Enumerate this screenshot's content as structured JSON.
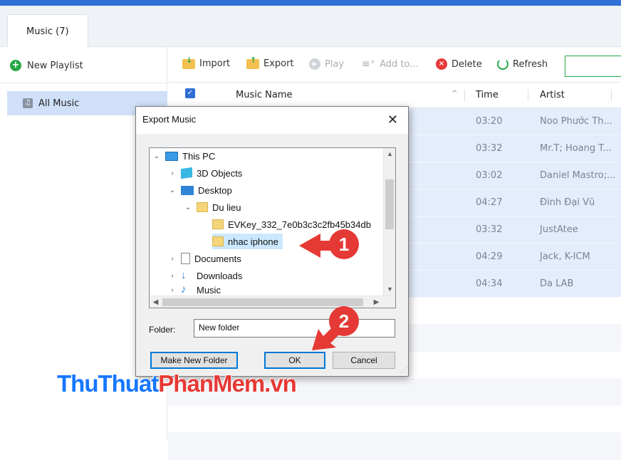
{
  "tab": {
    "label": "Music (7)"
  },
  "sidebar": {
    "new_playlist": "New Playlist",
    "all_music": "All Music"
  },
  "toolbar": {
    "import": "Import",
    "export": "Export",
    "play": "Play",
    "add_to": "Add to...",
    "delete": "Delete",
    "refresh": "Refresh"
  },
  "table": {
    "headers": {
      "name": "Music Name",
      "time": "Time",
      "artist": "Artist"
    },
    "rows": [
      {
        "time": "03:20",
        "artist": "Noo Phước Th..."
      },
      {
        "time": "03:32",
        "artist": "Mr.T; Hoang T..."
      },
      {
        "time": "03:02",
        "artist": "Daniel Mastro;..."
      },
      {
        "time": "04:27",
        "artist": "Đinh Đại Vũ"
      },
      {
        "time": "03:32",
        "artist": "JustAtee"
      },
      {
        "time": "04:29",
        "artist": "Jack,  K-ICM"
      },
      {
        "time": "04:34",
        "artist": "Da LAB"
      }
    ]
  },
  "dialog": {
    "title": "Export Music",
    "tree": {
      "this_pc": "This PC",
      "objects3d": "3D Objects",
      "desktop": "Desktop",
      "du_lieu": "Du lieu",
      "evkey": "EVKey_332_7e0b3c3c2fb45b34db",
      "nhac_iphone": "nhac iphone",
      "documents": "Documents",
      "downloads": "Downloads",
      "music_partial": "Music"
    },
    "folder_label": "Folder:",
    "folder_value": "New folder",
    "make_new_folder": "Make New Folder",
    "ok": "OK",
    "cancel": "Cancel"
  },
  "annotations": {
    "step1": "1",
    "step2": "2"
  },
  "watermark": {
    "part1": "ThuThuat",
    "part2": "PhanMem.vn"
  },
  "colors": {
    "accent": "#2f6fd6",
    "selected_row": "#e3edfb",
    "badge": "#e53935"
  }
}
